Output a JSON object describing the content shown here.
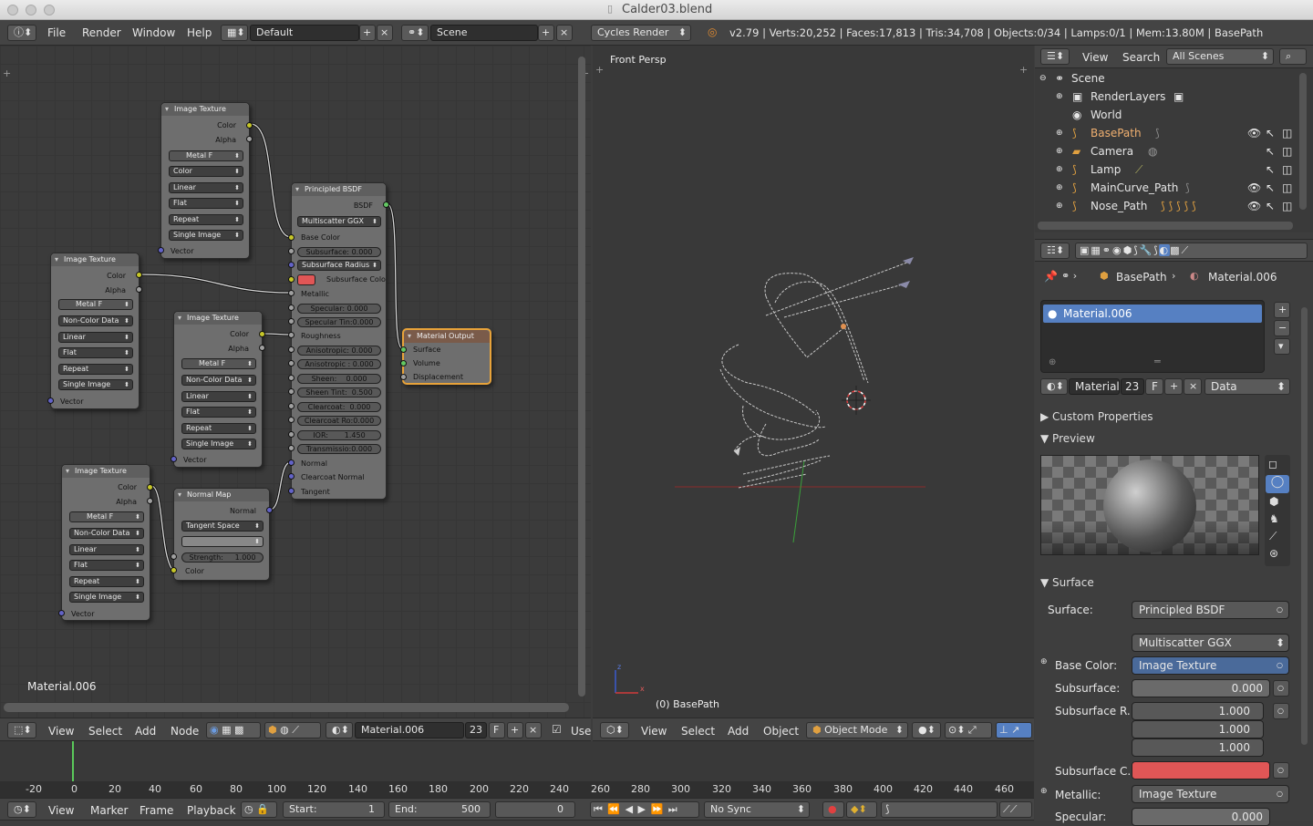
{
  "window": {
    "title": "Calder03.blend"
  },
  "top_menu": {
    "items": [
      "File",
      "Render",
      "Window",
      "Help"
    ],
    "screen_layout": "Default",
    "scene": "Scene",
    "engine": "Cycles Render",
    "stats": "v2.79 | Verts:20,252 | Faces:17,813 | Tris:34,708 | Objects:0/34 | Lamps:0/1 | Mem:13.80M | BasePath"
  },
  "node_editor": {
    "material_label": "Material.006",
    "nodes": {
      "tex1": {
        "title": "Image Texture",
        "color": "Color",
        "alpha": "Alpha",
        "img": "Metal",
        "f": "F",
        "color_space": "Color",
        "interp": "Linear",
        "proj": "Flat",
        "ext": "Repeat",
        "source": "Single Image",
        "vector": "Vector"
      },
      "tex2": {
        "title": "Image Texture",
        "color": "Color",
        "alpha": "Alpha",
        "img": "Metal",
        "f": "F",
        "color_space": "Non-Color Data",
        "interp": "Linear",
        "proj": "Flat",
        "ext": "Repeat",
        "source": "Single Image",
        "vector": "Vector"
      },
      "tex3": {
        "title": "Image Texture",
        "color": "Color",
        "alpha": "Alpha",
        "img": "Metal",
        "f": "F",
        "color_space": "Non-Color Data",
        "interp": "Linear",
        "proj": "Flat",
        "ext": "Repeat",
        "source": "Single Image",
        "vector": "Vector"
      },
      "tex4": {
        "title": "Image Texture",
        "color": "Color",
        "alpha": "Alpha",
        "img": "Metal",
        "f": "F",
        "color_space": "Non-Color Data",
        "interp": "Linear",
        "proj": "Flat",
        "ext": "Repeat",
        "source": "Single Image",
        "vector": "Vector"
      },
      "normal_map": {
        "title": "Normal Map",
        "normal": "Normal",
        "space": "Tangent Space",
        "strength": "Strength:",
        "strength_val": "1.000",
        "color": "Color"
      },
      "bsdf": {
        "title": "Principled BSDF",
        "out": "BSDF",
        "dist": "Multiscatter GGX",
        "base_color": "Base Color",
        "subsurface": "Subsurface:",
        "subsurface_val": "0.000",
        "subsurface_radius": "Subsurface Radius",
        "subsurface_color": "Subsurface Colo",
        "metallic": "Metallic",
        "specular": "Specular:",
        "specular_val": "0.000",
        "specular_tint": "Specular Tin:",
        "specular_tint_val": "0.000",
        "roughness": "Roughness",
        "aniso": "Anisotropic:",
        "aniso_val": "0.000",
        "aniso2": "Anisotropic :",
        "aniso2_val": "0.000",
        "sheen": "Sheen:",
        "sheen_val": "0.000",
        "sheen_tint": "Sheen Tint:",
        "sheen_tint_val": "0.500",
        "clearcoat": "Clearcoat:",
        "clearcoat_val": "0.000",
        "clearcoat_ro": "Clearcoat Ro:",
        "clearcoat_ro_val": "0.000",
        "ior": "IOR:",
        "ior_val": "1.450",
        "transmission": "Transmissio:",
        "transmission_val": "0.000",
        "normal": "Normal",
        "clearcoat_normal": "Clearcoat Normal",
        "tangent": "Tangent"
      },
      "output": {
        "title": "Material Output",
        "surface": "Surface",
        "volume": "Volume",
        "displacement": "Displacement"
      }
    },
    "header": {
      "menus": [
        "View",
        "Select",
        "Add",
        "Node"
      ],
      "material": "Material.006",
      "users": "23",
      "f": "F",
      "use": "Use"
    }
  },
  "viewport": {
    "label": "Front Persp",
    "object": "(0) BasePath",
    "menus": [
      "View",
      "Select",
      "Add",
      "Object"
    ],
    "mode": "Object Mode"
  },
  "outliner": {
    "menus": [
      "View",
      "Search"
    ],
    "filter": "All Scenes",
    "items": [
      "Scene",
      "RenderLayers",
      "World",
      "BasePath",
      "Camera",
      "Lamp",
      "MainCurve_Path",
      "Nose_Path"
    ]
  },
  "properties": {
    "breadcrumb": [
      "BasePath",
      "Material.006"
    ],
    "slot": "Material.006",
    "mat_name": "Material.",
    "mat_users": "23",
    "mat_f": "F",
    "link": "Data",
    "panels": {
      "custom": "Custom Properties",
      "preview": "Preview",
      "surface": "Surface"
    },
    "surface_label": "Surface:",
    "surface_val": "Principled BSDF",
    "dist": "Multiscatter GGX",
    "base_color_label": "Base Color:",
    "base_color_val": "Image Texture",
    "subsurface_label": "Subsurface:",
    "subsurface_val": "0.000",
    "subsurface_r_label": "Subsurface R...",
    "sr1": "1.000",
    "sr2": "1.000",
    "sr3": "1.000",
    "subsurface_c_label": "Subsurface C...",
    "metallic_label": "Metallic:",
    "metallic_val": "Image Texture",
    "specular_label": "Specular:",
    "specular_val": "0.000",
    "subsurface_color": "#e05656"
  },
  "timeline": {
    "ticks": [
      "-20",
      "0",
      "20",
      "40",
      "60",
      "80",
      "100",
      "120",
      "140",
      "160",
      "180",
      "200",
      "220",
      "240",
      "260",
      "280",
      "300",
      "320",
      "340",
      "360",
      "380",
      "400",
      "420",
      "440",
      "460"
    ],
    "menus": [
      "View",
      "Marker",
      "Frame",
      "Playback"
    ],
    "start_label": "Start:",
    "start": "1",
    "end_label": "End:",
    "end": "500",
    "current": "0",
    "sync": "No Sync"
  }
}
